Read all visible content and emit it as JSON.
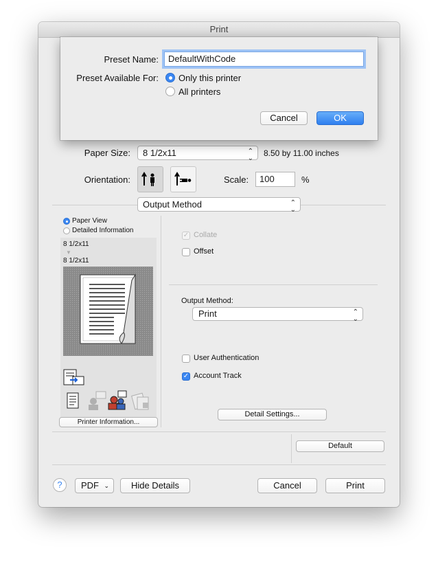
{
  "window": {
    "title": "Print"
  },
  "preset_sheet": {
    "name_label": "Preset Name:",
    "name_value": "DefaultWithCode",
    "available_label": "Preset Available For:",
    "option_only": "Only this printer",
    "option_all": "All printers",
    "cancel_label": "Cancel",
    "ok_label": "OK"
  },
  "paper": {
    "size_label": "Paper Size:",
    "size_value": "8 1/2x11",
    "size_desc": "8.50 by 11.00 inches",
    "orientation_label": "Orientation:",
    "scale_label": "Scale:",
    "scale_value": "100",
    "scale_unit": "%"
  },
  "section_popup": {
    "value": "Output Method"
  },
  "preview": {
    "paper_view": "Paper View",
    "detailed_info": "Detailed Information",
    "size_top": "8 1/2x11",
    "size_bottom": "8 1/2x11",
    "printer_info_button": "Printer Information..."
  },
  "options": {
    "collate": "Collate",
    "offset": "Offset",
    "output_method_label": "Output Method:",
    "output_method_value": "Print",
    "user_auth": "User Authentication",
    "account_track": "Account Track",
    "detail_settings": "Detail Settings...",
    "default_button": "Default"
  },
  "bottom": {
    "help": "?",
    "pdf": "PDF",
    "hide_details": "Hide Details",
    "cancel": "Cancel",
    "print": "Print"
  },
  "colors": {
    "accent": "#3b87f2",
    "window_bg": "#ececec"
  }
}
